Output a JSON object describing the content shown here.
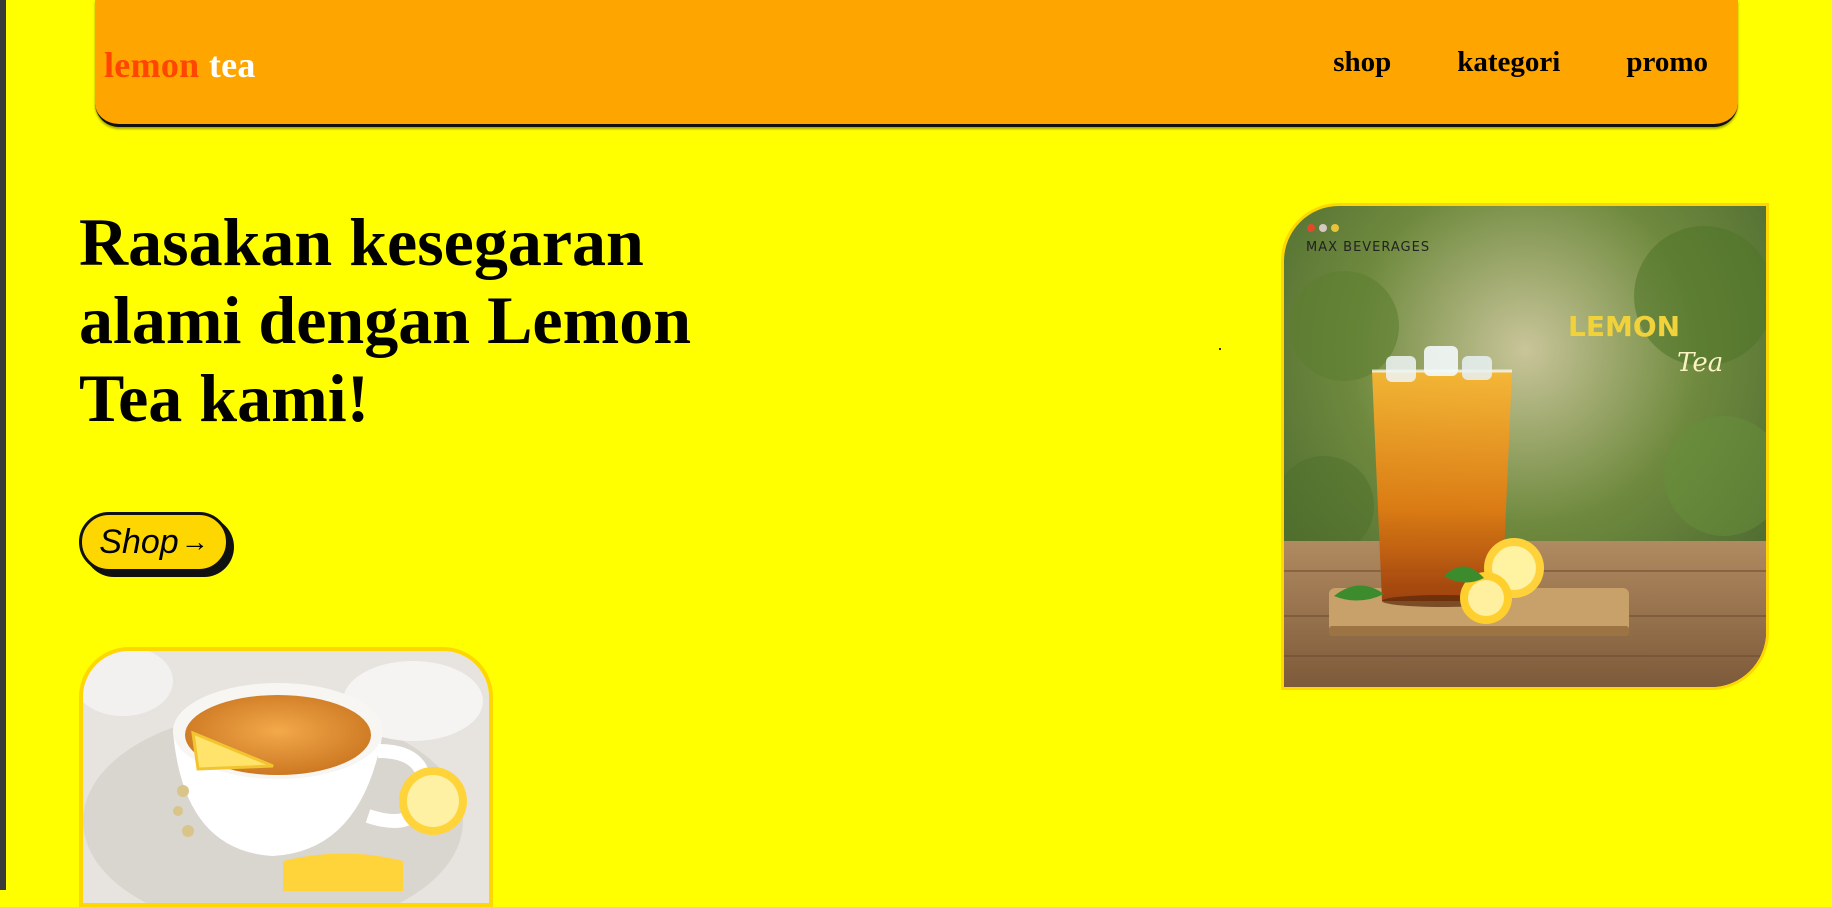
{
  "nav": {
    "logo_part1": "lemon",
    "logo_part2": "tea",
    "links": [
      "shop",
      "kategori",
      "promo"
    ]
  },
  "hero": {
    "headline": "Rasakan kesegaran alami dengan Lemon Tea kami!",
    "button_label": "Shop",
    "button_arrow": "→"
  },
  "product_image": {
    "brand_text": "MAX BEVERAGES",
    "title_text": "LEMON",
    "subtitle_text": "Tea"
  },
  "colors": {
    "page_background": "#ffff00",
    "navbar": "#ffa500",
    "logo_accent": "#ff4500",
    "button": "#ffd700"
  }
}
